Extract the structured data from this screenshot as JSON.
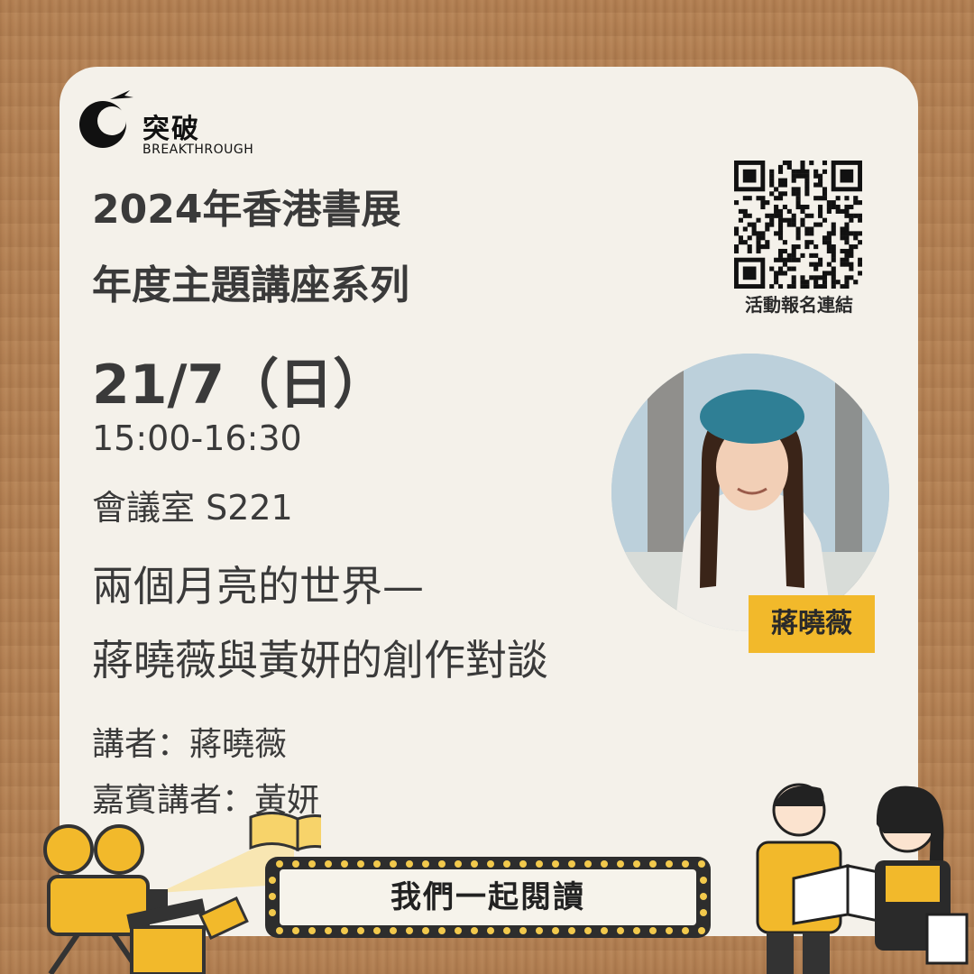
{
  "brand": {
    "name_cn": "突破",
    "name_en": "BREAKTHROUGH"
  },
  "event": {
    "title_line1": "2024年香港書展",
    "title_line2": "年度主題講座系列",
    "date": "21/7（日）",
    "time": "15:00-16:30",
    "venue": "會議室 S221",
    "topic_line1": "兩個月亮的世界—",
    "topic_line2": "蔣曉薇與黃妍的創作對談",
    "speaker": "講者：蔣曉薇",
    "guest_speaker": "嘉賓講者：黃妍"
  },
  "qr": {
    "label": "活動報名連結"
  },
  "photo": {
    "name_tag": "蔣曉薇"
  },
  "banner": {
    "text": "我們一起閱讀"
  },
  "colors": {
    "background_wood": "#b27f52",
    "card": "#f4f1ea",
    "text": "#3a3a3a",
    "accent_yellow": "#f2b92b",
    "banner_frame": "#2d2d2d"
  },
  "icons": [
    "breakthrough-logo-icon",
    "qr-code-icon",
    "film-projector-icon",
    "open-book-icon",
    "clapperboard-icon",
    "film-reel-icon",
    "reading-kids-illustration"
  ]
}
